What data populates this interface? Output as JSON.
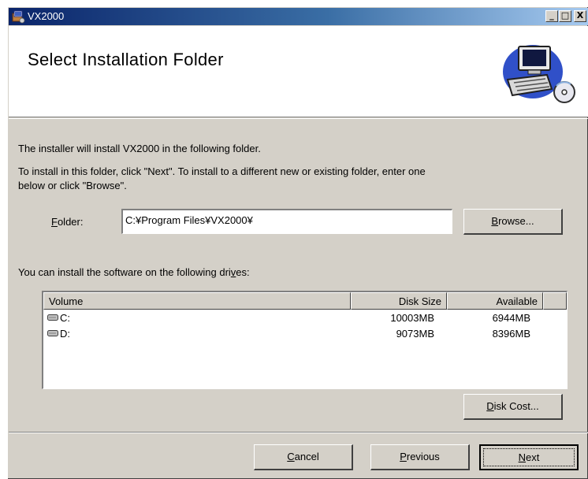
{
  "window": {
    "title": "VX2000",
    "controls": {
      "minimize": "_",
      "maximize": "□",
      "close": "X"
    }
  },
  "header": {
    "title": "Select Installation Folder",
    "art_icon": "computer-with-disc-icon"
  },
  "body": {
    "intro": "The installer will install VX2000 in the following folder.",
    "instructions_line1": "To install in this folder, click \"Next\". To install to a different new or existing folder, enter one",
    "instructions_line2": "below or click \"Browse\".",
    "folder_label_accel": "F",
    "folder_label_rest": "older:",
    "folder_value": "C:¥Program Files¥VX2000¥",
    "browse_accel": "B",
    "browse_rest": "rowse...",
    "drives_text_pre": "You can install the software on the following dri",
    "drives_text_accel": "v",
    "drives_text_post": "es:"
  },
  "drives": {
    "columns": [
      "Volume",
      "Disk Size",
      "Available"
    ],
    "rows": [
      {
        "volume": "C:",
        "disk_size": "10003MB",
        "available": "6944MB"
      },
      {
        "volume": "D:",
        "disk_size": "9073MB",
        "available": "8396MB"
      }
    ]
  },
  "disk_cost": {
    "accel": "D",
    "rest": "isk Cost..."
  },
  "footer": {
    "cancel_accel": "C",
    "cancel_rest": "ancel",
    "previous_accel": "P",
    "previous_rest": "revious",
    "next_accel": "N",
    "next_rest": "ext"
  },
  "colors": {
    "face": "#d4d0c8",
    "title_start": "#0a246a",
    "title_end": "#a6caf0",
    "header_bg": "#ffffff"
  }
}
